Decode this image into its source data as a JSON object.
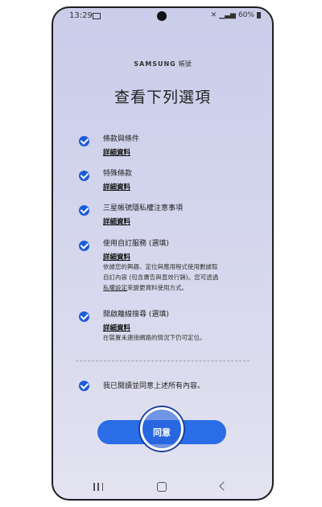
{
  "status": {
    "time": "13:29",
    "right_text": "60%"
  },
  "header": {
    "brand": "SAMSUNG",
    "brand_sub": "帳號",
    "title": "查看下列選項"
  },
  "items": [
    {
      "label": "條款與條件",
      "link": "詳細資料"
    },
    {
      "label": "特殊條款",
      "link": "詳細資料"
    },
    {
      "label": "三星帳號隱私權注意事項",
      "link": "詳細資料"
    },
    {
      "label": "使用自訂服務 (選填)",
      "link": "詳細資料",
      "desc1": "依據您的興趣、定位與應用程式使用數據取",
      "desc2": "自訂內容 (包含廣告與直效行銷)。您可透過",
      "desc3_link": "私權設定",
      "desc3_rest": "來變更資料使用方式。"
    },
    {
      "label": "開啟離線搜尋 (選填)",
      "link": "詳細資料",
      "desc1": "在裝置未連接網路的情況下仍可定位。"
    }
  ],
  "agree_all": {
    "label": "我已閱讀並同意上述所有內容。"
  },
  "agree_button": {
    "label": "同意"
  },
  "colors": {
    "accent": "#2a6de6",
    "check": "#1e5bd6"
  }
}
